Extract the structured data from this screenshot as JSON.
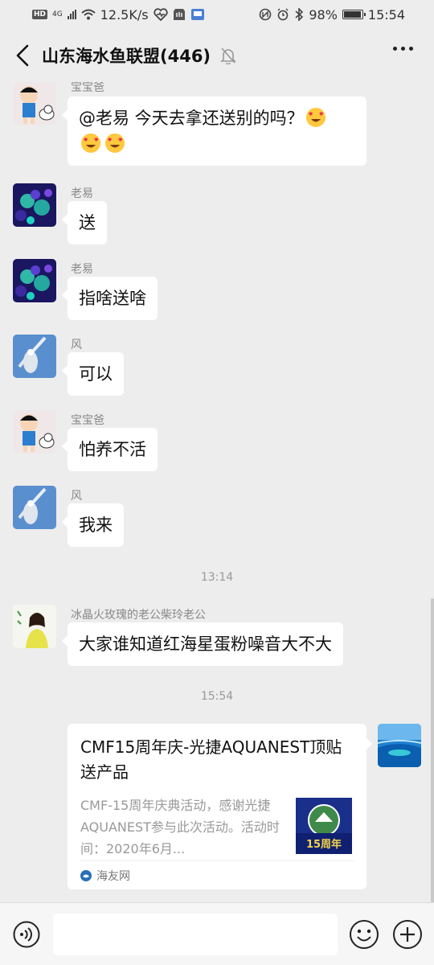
{
  "status_bar": {
    "hd_badge": "HD",
    "network_type": "4G",
    "net_speed": "12.5K/s",
    "battery_percent": "98%",
    "battery_level": 0.98,
    "time": "15:54"
  },
  "header": {
    "title": "山东海水鱼联盟(446)",
    "back_icon": "chevron-left-icon",
    "mute_icon": "bell-off-icon",
    "more_icon": "more-horizontal-icon"
  },
  "messages": [
    {
      "sender": "宝宝爸",
      "text": "@老易   今天去拿还送别的吗？",
      "avatar": "cartoon-boy-avatar",
      "emoji": "heart-eyes-emoji",
      "emoji_count": 3
    },
    {
      "sender": "老易",
      "text": "送",
      "avatar": "coral-avatar"
    },
    {
      "sender": "老易",
      "text": "指啥送啥",
      "avatar": "coral-avatar"
    },
    {
      "sender": "风",
      "text": "可以",
      "avatar": "bird-avatar"
    },
    {
      "sender": "宝宝爸",
      "text": "怕养不活",
      "avatar": "cartoon-boy-avatar"
    },
    {
      "sender": "风",
      "text": "我来",
      "avatar": "bird-avatar"
    },
    {
      "sender": "冰晶火玫瑰的老公柴玲老公",
      "text": "大家谁知道红海星蛋粉噪音大不大",
      "avatar": "girl-photo-avatar"
    }
  ],
  "timestamps": [
    "13:14",
    "15:54"
  ],
  "link_card": {
    "title": "CMF15周年庆-光捷AQUANEST顶贴送产品",
    "description": "CMF-15周年庆典活动，感谢光捷AQUANEST参与此次活动。活动时间：2020年6月...",
    "thumb_label": "15周年",
    "source": "海友网",
    "source_icon": "haiyou-logo-icon"
  },
  "input_bar": {
    "voice_icon": "voice-icon",
    "input_value": "",
    "emoji_icon": "smiley-icon",
    "plus_icon": "plus-circle-icon"
  },
  "colors": {
    "background": "#ededed",
    "bubble": "#ffffff",
    "text": "#111111",
    "secondary_text": "#888888"
  }
}
